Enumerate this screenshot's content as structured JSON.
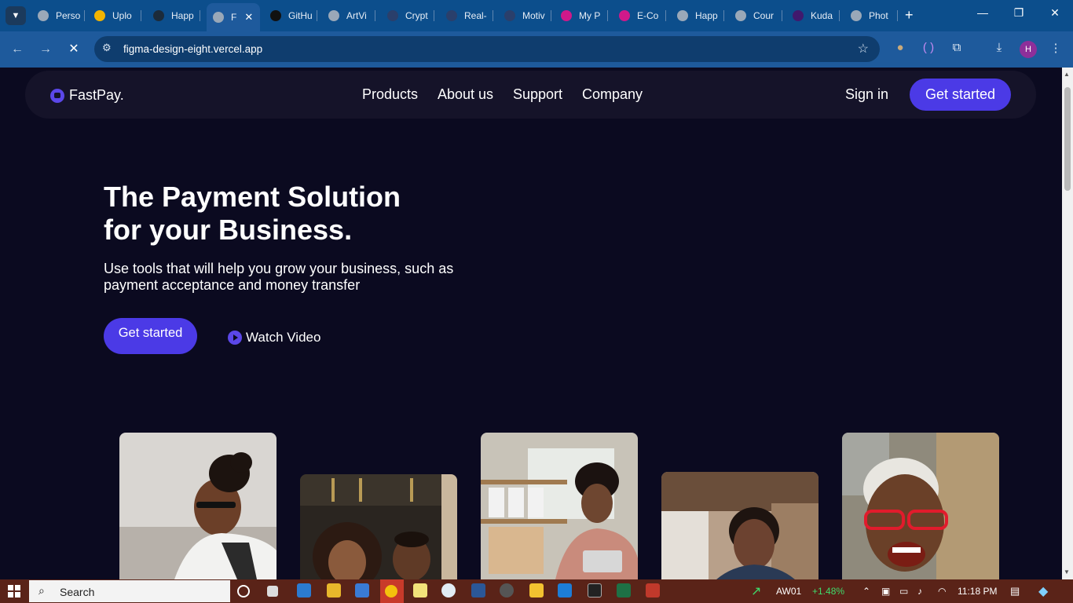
{
  "browser": {
    "tabs": [
      {
        "label": "Perso",
        "fav": "#9aa8b8"
      },
      {
        "label": "Uplo",
        "fav": "#f2b400"
      },
      {
        "label": "Happ",
        "fav": "#1c2b3a"
      },
      {
        "label": "F",
        "fav": "#9aa8b8",
        "active": true
      },
      {
        "label": "GitHu",
        "fav": "#111111"
      },
      {
        "label": "ArtVi",
        "fav": "#9aa8b8"
      },
      {
        "label": "Crypt",
        "fav": "#2a3f6b"
      },
      {
        "label": "Real-",
        "fav": "#2a3f6b"
      },
      {
        "label": "Motiv",
        "fav": "#2a3f6b"
      },
      {
        "label": "My P",
        "fav": "#d0198a"
      },
      {
        "label": "E-Co",
        "fav": "#d0198a"
      },
      {
        "label": "Happ",
        "fav": "#9aa8b8"
      },
      {
        "label": "Cour",
        "fav": "#9aa8b8"
      },
      {
        "label": "Kuda",
        "fav": "#40196d"
      },
      {
        "label": "Phot",
        "fav": "#9aa8b8"
      }
    ],
    "url": "figma-design-eight.vercel.app",
    "profile_initial": "H"
  },
  "site": {
    "logo": "FastPay.",
    "nav": [
      "Products",
      "About us",
      "Support",
      "Company"
    ],
    "signin": "Sign in",
    "cta_top": "Get started",
    "hero_title_1": "The Payment Solution",
    "hero_title_2": "for your Business.",
    "hero_sub": "Use tools that will help you grow your business, such as payment acceptance and money transfer",
    "cta_main": "Get started",
    "watch_video": "Watch Video",
    "accent": "#4b3ae6",
    "background": "#0b0a20"
  },
  "taskbar": {
    "search": "Search",
    "stock_name": "AW01",
    "stock_change": "+1.48%",
    "time": "11:18 PM"
  }
}
